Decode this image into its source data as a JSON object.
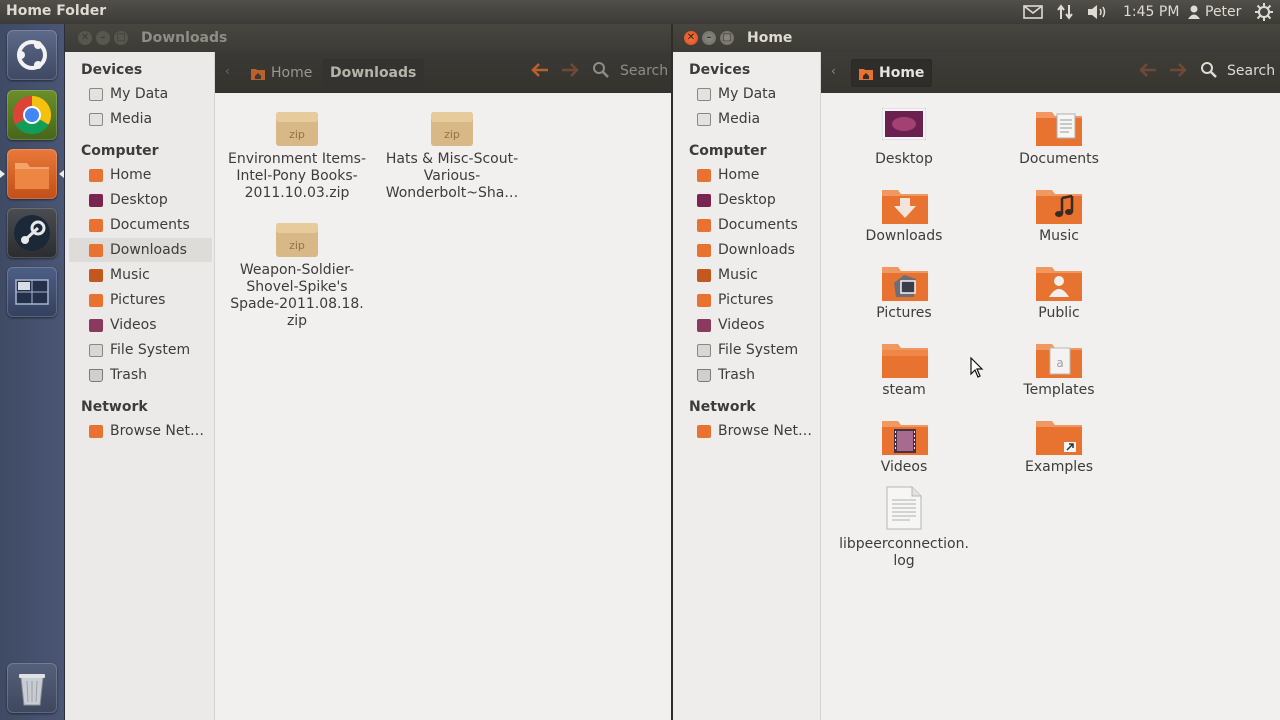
{
  "top_panel": {
    "title": "Home Folder",
    "time": "1:45 PM",
    "user": "Peter",
    "icons": [
      "mail-icon",
      "network-icon",
      "volume-icon",
      "user-icon",
      "settings-gear-icon"
    ]
  },
  "launcher": {
    "items": [
      "ubuntu-dash-icon",
      "chrome-icon",
      "files-icon",
      "steam-icon",
      "workspace-switcher-icon",
      "trash-icon"
    ]
  },
  "left_window": {
    "title": "Downloads",
    "breadcrumbs": [
      "Home",
      "Downloads"
    ],
    "search_label": "Search",
    "sidebar": {
      "devices_header": "Devices",
      "devices": [
        "My Data",
        "Media"
      ],
      "computer_header": "Computer",
      "computer": [
        "Home",
        "Desktop",
        "Documents",
        "Downloads",
        "Music",
        "Pictures",
        "Videos",
        "File System",
        "Trash"
      ],
      "network_header": "Network",
      "network": [
        "Browse Net…"
      ]
    },
    "files": [
      {
        "name": "Environment Items-Intel-Pony Books-2011.10.03.zip",
        "lines": [
          "Environment Items-",
          "Intel-Pony Books-",
          "2011.10.03.zip"
        ],
        "badge": "zip"
      },
      {
        "name": "Hats & Misc-Scout-Various-Wonderbolt~Sha…",
        "lines": [
          "Hats & Misc-Scout-",
          "Various-",
          "Wonderbolt~Sha…"
        ],
        "badge": "zip"
      },
      {
        "name": "Weapon-Soldier-Shovel-Spike's Spade-2011.08.18.zip",
        "lines": [
          "Weapon-Soldier-",
          "Shovel-Spike's",
          "Spade-2011.08.18.",
          "zip"
        ],
        "badge": "zip"
      }
    ]
  },
  "right_window": {
    "title": "Home",
    "breadcrumbs": [
      "Home"
    ],
    "search_label": "Search",
    "sidebar": {
      "devices_header": "Devices",
      "devices": [
        "My Data",
        "Media"
      ],
      "computer_header": "Computer",
      "computer": [
        "Home",
        "Desktop",
        "Documents",
        "Downloads",
        "Music",
        "Pictures",
        "Videos",
        "File System",
        "Trash"
      ],
      "network_header": "Network",
      "network": [
        "Browse Net…"
      ]
    },
    "items": [
      {
        "label": "Desktop",
        "icon": "desktop-folder-icon"
      },
      {
        "label": "Documents",
        "icon": "documents-folder-icon"
      },
      {
        "label": "Downloads",
        "icon": "downloads-folder-icon"
      },
      {
        "label": "Music",
        "icon": "music-folder-icon"
      },
      {
        "label": "Pictures",
        "icon": "pictures-folder-icon"
      },
      {
        "label": "Public",
        "icon": "public-folder-icon"
      },
      {
        "label": "steam",
        "icon": "folder-icon"
      },
      {
        "label": "Templates",
        "icon": "templates-folder-icon"
      },
      {
        "label": "Videos",
        "icon": "videos-folder-icon"
      },
      {
        "label": "Examples",
        "icon": "examples-folder-icon"
      }
    ],
    "log_file": {
      "label_lines": [
        "libpeerconnection.",
        "log"
      ],
      "icon": "text-file-icon"
    }
  },
  "colors": {
    "ubuntu_orange": "#dd4814",
    "folder_orange": "#e8722f",
    "panel_dark": "#3c3b37",
    "launcher_blue": "#45506c",
    "close_button": "#e05a2a"
  }
}
